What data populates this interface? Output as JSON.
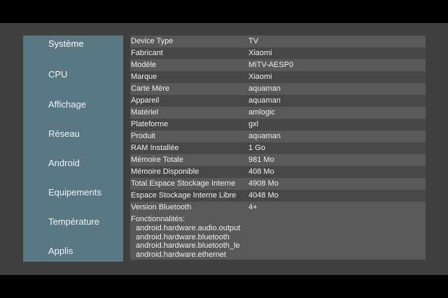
{
  "sidebar": {
    "items": [
      {
        "label": "Système",
        "active": true
      },
      {
        "label": "CPU"
      },
      {
        "label": "Affichage"
      },
      {
        "label": "Réseau"
      },
      {
        "label": "Android"
      },
      {
        "label": "Equipements"
      },
      {
        "label": "Température"
      },
      {
        "label": "Applis"
      }
    ]
  },
  "info": {
    "rows": [
      {
        "key": "Device Type",
        "value": "TV"
      },
      {
        "key": "Fabricant",
        "value": "Xiaomi"
      },
      {
        "key": "Modèle",
        "value": "MiTV-AESP0"
      },
      {
        "key": "Marque",
        "value": "Xiaomi"
      },
      {
        "key": "Carte Mère",
        "value": "aquaman"
      },
      {
        "key": "Appareil",
        "value": "aquaman"
      },
      {
        "key": "Matériel",
        "value": "amlogic"
      },
      {
        "key": "Plateforme",
        "value": "gxl"
      },
      {
        "key": "Produit",
        "value": "aquaman"
      },
      {
        "key": "RAM Installée",
        "value": "1 Go"
      },
      {
        "key": "Mémoire Totale",
        "value": "981 Mo"
      },
      {
        "key": "Mémoire Disponible",
        "value": "408 Mo"
      },
      {
        "key": "Total Espace Stockage Interne",
        "value": "4908 Mo"
      },
      {
        "key": "Espace Stockage Interne Libre",
        "value": "4048 Mo"
      },
      {
        "key": "Version Bluetooth",
        "value": "4+"
      }
    ],
    "features_title": "Fonctionnalités:",
    "features": [
      "android.hardware.audio.output",
      "android.hardware.bluetooth",
      "android.hardware.bluetooth_le",
      "android.hardware.ethernet"
    ]
  },
  "colors": {
    "sidebar_bg": "#5a7884",
    "background": "#404040",
    "row_light": "#595959",
    "row_dark": "#474747"
  }
}
